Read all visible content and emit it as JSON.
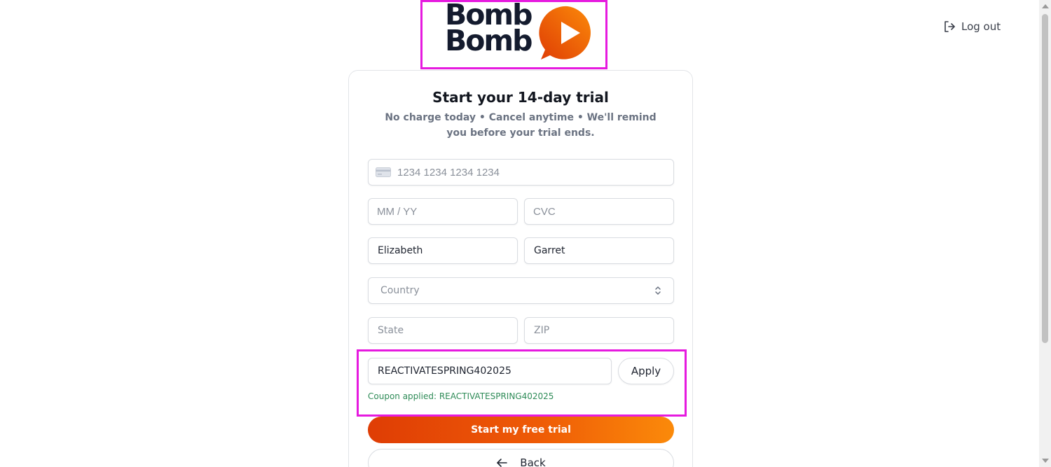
{
  "brand": {
    "logo_line1": "Bomb",
    "logo_line2": "Bomb",
    "logo_icon": "play-bubble-icon",
    "accent_start": "#df3d05",
    "accent_end": "#fb8a0a",
    "dark": "#141b2e"
  },
  "header": {
    "logout_label": "Log out",
    "logout_icon": "logout-icon"
  },
  "form": {
    "title": "Start your 14-day trial",
    "subtitle": "No charge today • Cancel anytime • We'll remind you before your trial ends.",
    "card_number": {
      "placeholder": "1234 1234 1234 1234",
      "value": "",
      "icon": "credit-card-icon"
    },
    "expiry": {
      "placeholder": "MM / YY",
      "value": ""
    },
    "cvc": {
      "placeholder": "CVC",
      "value": ""
    },
    "first_name": {
      "value": "Elizabeth"
    },
    "last_name": {
      "value": "Garret"
    },
    "country": {
      "placeholder": "Country",
      "icon": "chevron-updown-icon"
    },
    "state": {
      "placeholder": "State",
      "value": ""
    },
    "zip": {
      "placeholder": "ZIP",
      "value": ""
    },
    "coupon": {
      "value": "REACTIVATESPRING402025",
      "apply_label": "Apply",
      "applied_message": "Coupon applied: REACTIVATESPRING402025",
      "success_color": "#2e8b57"
    },
    "start_label": "Start my free trial",
    "back_label": "Back",
    "back_icon": "arrow-left-icon"
  },
  "highlight_color": "#e61adf"
}
